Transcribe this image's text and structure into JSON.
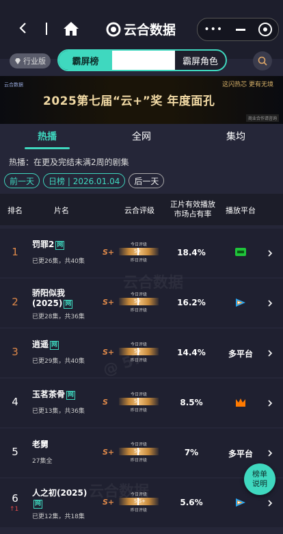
{
  "app": {
    "name": "云合数据"
  },
  "category_badge": "行业版",
  "segments": [
    "霸屏榜",
    "",
    "霸屏角色"
  ],
  "banner": {
    "headline": "2025第七届“云+”奖 年度面孔",
    "logo": "云合数据",
    "right_slogan": "这闪热芯 更有无境",
    "note": "商业合作请咨询"
  },
  "main_tabs": [
    "热播",
    "全网",
    "集均"
  ],
  "description": "热播：在更及完结未满2周的剧集",
  "dates": {
    "prev": "前一天",
    "current": "日榜 | 2026.01.04",
    "next": "后一天"
  },
  "headers": {
    "rank": "排名",
    "title": "片名",
    "grade": "云合评级",
    "share": "正片有效播放\n市场占有率",
    "platform": "播放平台"
  },
  "grade_labels": {
    "today": "今日评级",
    "yesterday": "昨日评级"
  },
  "rows": [
    {
      "rank": "1",
      "title": "罚罪2",
      "tag": "网",
      "sub": "已更26集，共40集",
      "grade": "S+",
      "bar": "S+",
      "share": "18.4%",
      "platform": "",
      "platform_icon": "iqiyi-icon",
      "change": ""
    },
    {
      "rank": "2",
      "title": "骄阳似我(2025)",
      "tag": "网",
      "sub": "已更28集，共36集",
      "grade": "S+",
      "bar": "S+",
      "share": "16.2%",
      "platform": "",
      "platform_icon": "tencent-video-icon",
      "change": ""
    },
    {
      "rank": "3",
      "title": "逍遥",
      "tag": "网",
      "sub": "已更29集，共40集",
      "grade": "S+",
      "bar": "S+",
      "share": "14.4%",
      "platform": "多平台",
      "platform_icon": "",
      "change": ""
    },
    {
      "rank": "4",
      "title": "玉茗茶骨",
      "tag": "网",
      "sub": "已更13集，共36集",
      "grade": "S",
      "bar": "S",
      "share": "8.5%",
      "platform": "",
      "platform_icon": "mango-tv-icon",
      "change": ""
    },
    {
      "rank": "5",
      "title": "老舅",
      "tag": "",
      "sub": "27集全",
      "grade": "S+",
      "bar": "S+",
      "share": "7%",
      "platform": "多平台",
      "platform_icon": "",
      "change": ""
    },
    {
      "rank": "6",
      "title": "人之初(2025)",
      "tag": "网",
      "sub": "已更12集，共18集",
      "grade": "S+",
      "bar": "S  S+",
      "share": "5.6%",
      "platform": "",
      "platform_icon": "tencent-video-icon",
      "change": "1"
    }
  ],
  "float_button": {
    "line1": "榜单",
    "line2": "说明"
  },
  "colors": {
    "accent": "#3fd8bf",
    "rank_top": "#e08a4a",
    "background": "#252638"
  }
}
